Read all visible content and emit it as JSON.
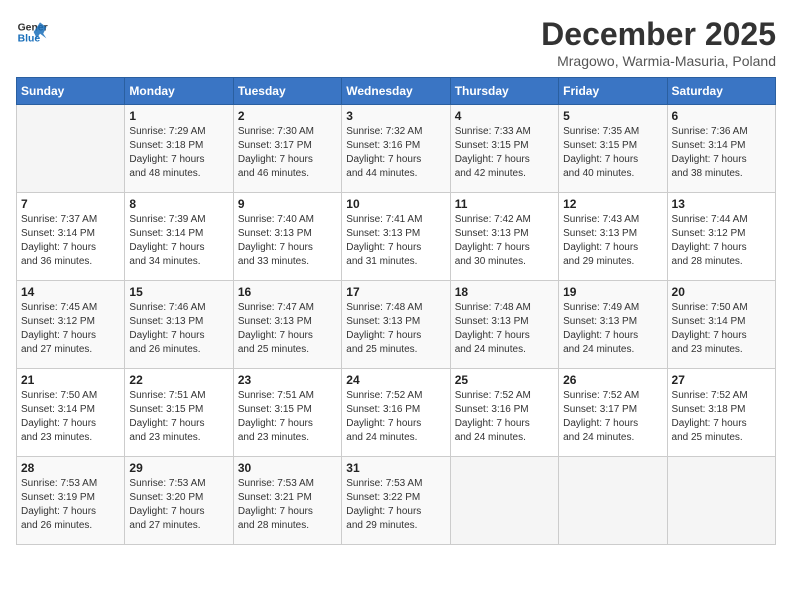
{
  "logo": {
    "line1": "General",
    "line2": "Blue"
  },
  "title": "December 2025",
  "subtitle": "Mragowo, Warmia-Masuria, Poland",
  "days_of_week": [
    "Sunday",
    "Monday",
    "Tuesday",
    "Wednesday",
    "Thursday",
    "Friday",
    "Saturday"
  ],
  "weeks": [
    [
      {
        "day": "",
        "info": ""
      },
      {
        "day": "1",
        "info": "Sunrise: 7:29 AM\nSunset: 3:18 PM\nDaylight: 7 hours\nand 48 minutes."
      },
      {
        "day": "2",
        "info": "Sunrise: 7:30 AM\nSunset: 3:17 PM\nDaylight: 7 hours\nand 46 minutes."
      },
      {
        "day": "3",
        "info": "Sunrise: 7:32 AM\nSunset: 3:16 PM\nDaylight: 7 hours\nand 44 minutes."
      },
      {
        "day": "4",
        "info": "Sunrise: 7:33 AM\nSunset: 3:15 PM\nDaylight: 7 hours\nand 42 minutes."
      },
      {
        "day": "5",
        "info": "Sunrise: 7:35 AM\nSunset: 3:15 PM\nDaylight: 7 hours\nand 40 minutes."
      },
      {
        "day": "6",
        "info": "Sunrise: 7:36 AM\nSunset: 3:14 PM\nDaylight: 7 hours\nand 38 minutes."
      }
    ],
    [
      {
        "day": "7",
        "info": "Sunrise: 7:37 AM\nSunset: 3:14 PM\nDaylight: 7 hours\nand 36 minutes."
      },
      {
        "day": "8",
        "info": "Sunrise: 7:39 AM\nSunset: 3:14 PM\nDaylight: 7 hours\nand 34 minutes."
      },
      {
        "day": "9",
        "info": "Sunrise: 7:40 AM\nSunset: 3:13 PM\nDaylight: 7 hours\nand 33 minutes."
      },
      {
        "day": "10",
        "info": "Sunrise: 7:41 AM\nSunset: 3:13 PM\nDaylight: 7 hours\nand 31 minutes."
      },
      {
        "day": "11",
        "info": "Sunrise: 7:42 AM\nSunset: 3:13 PM\nDaylight: 7 hours\nand 30 minutes."
      },
      {
        "day": "12",
        "info": "Sunrise: 7:43 AM\nSunset: 3:13 PM\nDaylight: 7 hours\nand 29 minutes."
      },
      {
        "day": "13",
        "info": "Sunrise: 7:44 AM\nSunset: 3:12 PM\nDaylight: 7 hours\nand 28 minutes."
      }
    ],
    [
      {
        "day": "14",
        "info": "Sunrise: 7:45 AM\nSunset: 3:12 PM\nDaylight: 7 hours\nand 27 minutes."
      },
      {
        "day": "15",
        "info": "Sunrise: 7:46 AM\nSunset: 3:13 PM\nDaylight: 7 hours\nand 26 minutes."
      },
      {
        "day": "16",
        "info": "Sunrise: 7:47 AM\nSunset: 3:13 PM\nDaylight: 7 hours\nand 25 minutes."
      },
      {
        "day": "17",
        "info": "Sunrise: 7:48 AM\nSunset: 3:13 PM\nDaylight: 7 hours\nand 25 minutes."
      },
      {
        "day": "18",
        "info": "Sunrise: 7:48 AM\nSunset: 3:13 PM\nDaylight: 7 hours\nand 24 minutes."
      },
      {
        "day": "19",
        "info": "Sunrise: 7:49 AM\nSunset: 3:13 PM\nDaylight: 7 hours\nand 24 minutes."
      },
      {
        "day": "20",
        "info": "Sunrise: 7:50 AM\nSunset: 3:14 PM\nDaylight: 7 hours\nand 23 minutes."
      }
    ],
    [
      {
        "day": "21",
        "info": "Sunrise: 7:50 AM\nSunset: 3:14 PM\nDaylight: 7 hours\nand 23 minutes."
      },
      {
        "day": "22",
        "info": "Sunrise: 7:51 AM\nSunset: 3:15 PM\nDaylight: 7 hours\nand 23 minutes."
      },
      {
        "day": "23",
        "info": "Sunrise: 7:51 AM\nSunset: 3:15 PM\nDaylight: 7 hours\nand 23 minutes."
      },
      {
        "day": "24",
        "info": "Sunrise: 7:52 AM\nSunset: 3:16 PM\nDaylight: 7 hours\nand 24 minutes."
      },
      {
        "day": "25",
        "info": "Sunrise: 7:52 AM\nSunset: 3:16 PM\nDaylight: 7 hours\nand 24 minutes."
      },
      {
        "day": "26",
        "info": "Sunrise: 7:52 AM\nSunset: 3:17 PM\nDaylight: 7 hours\nand 24 minutes."
      },
      {
        "day": "27",
        "info": "Sunrise: 7:52 AM\nSunset: 3:18 PM\nDaylight: 7 hours\nand 25 minutes."
      }
    ],
    [
      {
        "day": "28",
        "info": "Sunrise: 7:53 AM\nSunset: 3:19 PM\nDaylight: 7 hours\nand 26 minutes."
      },
      {
        "day": "29",
        "info": "Sunrise: 7:53 AM\nSunset: 3:20 PM\nDaylight: 7 hours\nand 27 minutes."
      },
      {
        "day": "30",
        "info": "Sunrise: 7:53 AM\nSunset: 3:21 PM\nDaylight: 7 hours\nand 28 minutes."
      },
      {
        "day": "31",
        "info": "Sunrise: 7:53 AM\nSunset: 3:22 PM\nDaylight: 7 hours\nand 29 minutes."
      },
      {
        "day": "",
        "info": ""
      },
      {
        "day": "",
        "info": ""
      },
      {
        "day": "",
        "info": ""
      }
    ]
  ]
}
